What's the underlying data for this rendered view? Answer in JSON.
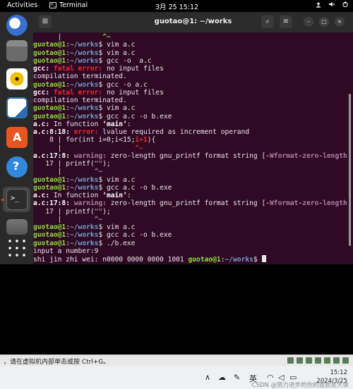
{
  "topbar": {
    "activities": "Activities",
    "app_name": "Terminal",
    "clock": "3月 25  15:12"
  },
  "dock": {
    "items": [
      {
        "icon": "thunderbird-icon"
      },
      {
        "icon": "files-icon"
      },
      {
        "icon": "rhythmbox-icon"
      },
      {
        "icon": "writer-icon"
      },
      {
        "icon": "app-center-icon"
      },
      {
        "icon": "help-icon"
      },
      {
        "icon": "terminal-icon"
      },
      {
        "icon": "drive-icon"
      },
      {
        "icon": "app-grid-icon"
      }
    ]
  },
  "terminal": {
    "title": "guotao@1: ~/works",
    "new_tab_icon": "new-tab-icon",
    "lines": [
      [
        {
          "t": "      |          ^~",
          "c": "g"
        }
      ],
      [
        {
          "t": "guotao@1",
          "c": "g"
        },
        {
          "t": ":",
          "c": ""
        },
        {
          "t": "~/works",
          "c": "b"
        },
        {
          "t": "$ vim a.c",
          "c": ""
        }
      ],
      [
        {
          "t": "guotao@1",
          "c": "g"
        },
        {
          "t": ":",
          "c": ""
        },
        {
          "t": "~/works",
          "c": "b"
        },
        {
          "t": "$ vim a.c",
          "c": ""
        }
      ],
      [
        {
          "t": "guotao@1",
          "c": "g"
        },
        {
          "t": ":",
          "c": ""
        },
        {
          "t": "~/works",
          "c": "b"
        },
        {
          "t": "$ gcc -o  a.c",
          "c": ""
        }
      ],
      [
        {
          "t": "gcc: ",
          "c": "w"
        },
        {
          "t": "fatal error: ",
          "c": "r"
        },
        {
          "t": "no input files",
          "c": ""
        }
      ],
      [
        {
          "t": "compilation terminated.",
          "c": ""
        }
      ],
      [
        {
          "t": "guotao@1",
          "c": "g"
        },
        {
          "t": ":",
          "c": ""
        },
        {
          "t": "~/works",
          "c": "b"
        },
        {
          "t": "$ gcc -o a.c",
          "c": ""
        }
      ],
      [
        {
          "t": "gcc: ",
          "c": "w"
        },
        {
          "t": "fatal error: ",
          "c": "r"
        },
        {
          "t": "no input files",
          "c": ""
        }
      ],
      [
        {
          "t": "compilation terminated.",
          "c": ""
        }
      ],
      [
        {
          "t": "guotao@1",
          "c": "g"
        },
        {
          "t": ":",
          "c": ""
        },
        {
          "t": "~/works",
          "c": "b"
        },
        {
          "t": "$ vim a.c",
          "c": ""
        }
      ],
      [
        {
          "t": "guotao@1",
          "c": "g"
        },
        {
          "t": ":",
          "c": ""
        },
        {
          "t": "~/works",
          "c": "b"
        },
        {
          "t": "$ gcc a.c -o b.exe",
          "c": ""
        }
      ],
      [
        {
          "t": "a.c:",
          "c": "w"
        },
        {
          "t": " In function ",
          "c": ""
        },
        {
          "t": "‘main’",
          "c": "w"
        },
        {
          "t": ":",
          "c": ""
        }
      ],
      [
        {
          "t": "a.c:8:18: ",
          "c": "w"
        },
        {
          "t": "error: ",
          "c": "r"
        },
        {
          "t": "lvalue required as increment operand",
          "c": ""
        }
      ],
      [
        {
          "t": "    8 | for(int i=0;i<15;",
          "c": ""
        },
        {
          "t": "i+1",
          "c": "r"
        },
        {
          "t": "){",
          "c": ""
        }
      ],
      [
        {
          "t": "      |                  ",
          "c": ""
        },
        {
          "t": "^~",
          "c": "r"
        }
      ],
      [
        {
          "t": "a.c:17:8: ",
          "c": "w"
        },
        {
          "t": "warning: ",
          "c": "m"
        },
        {
          "t": "zero-length gnu_printf format string [",
          "c": ""
        },
        {
          "t": "-Wformat-zero-length",
          "c": "m"
        },
        {
          "t": "]",
          "c": ""
        }
      ],
      [
        {
          "t": "   17 | printf(",
          "c": ""
        },
        {
          "t": "\"\"",
          "c": "m"
        },
        {
          "t": ");",
          "c": ""
        }
      ],
      [
        {
          "t": "      |        ",
          "c": ""
        },
        {
          "t": "^~",
          "c": "m"
        }
      ],
      [
        {
          "t": "guotao@1",
          "c": "g"
        },
        {
          "t": ":",
          "c": ""
        },
        {
          "t": "~/works",
          "c": "b"
        },
        {
          "t": "$ vim a.c",
          "c": ""
        }
      ],
      [
        {
          "t": "guotao@1",
          "c": "g"
        },
        {
          "t": ":",
          "c": ""
        },
        {
          "t": "~/works",
          "c": "b"
        },
        {
          "t": "$ gcc a.c -o b.exe",
          "c": ""
        }
      ],
      [
        {
          "t": "a.c:",
          "c": "w"
        },
        {
          "t": " In function ",
          "c": ""
        },
        {
          "t": "‘main’",
          "c": "w"
        },
        {
          "t": ":",
          "c": ""
        }
      ],
      [
        {
          "t": "a.c:17:8: ",
          "c": "w"
        },
        {
          "t": "warning: ",
          "c": "m"
        },
        {
          "t": "zero-length gnu_printf format string [",
          "c": ""
        },
        {
          "t": "-Wformat-zero-length",
          "c": "m"
        },
        {
          "t": "]",
          "c": ""
        }
      ],
      [
        {
          "t": "   17 | printf(",
          "c": ""
        },
        {
          "t": "\"\"",
          "c": "m"
        },
        {
          "t": ");",
          "c": ""
        }
      ],
      [
        {
          "t": "      |        ",
          "c": ""
        },
        {
          "t": "^~",
          "c": "m"
        }
      ],
      [
        {
          "t": "guotao@1",
          "c": "g"
        },
        {
          "t": ":",
          "c": ""
        },
        {
          "t": "~/works",
          "c": "b"
        },
        {
          "t": "$ vim a.c",
          "c": ""
        }
      ],
      [
        {
          "t": "guotao@1",
          "c": "g"
        },
        {
          "t": ":",
          "c": ""
        },
        {
          "t": "~/works",
          "c": "b"
        },
        {
          "t": "$ gcc a.c -o b.exe",
          "c": ""
        }
      ],
      [
        {
          "t": "guotao@1",
          "c": "g"
        },
        {
          "t": ":",
          "c": ""
        },
        {
          "t": "~/works",
          "c": "b"
        },
        {
          "t": "$ ./b.exe",
          "c": ""
        }
      ],
      [
        {
          "t": "input a number:9",
          "c": ""
        }
      ],
      [
        {
          "t": "shi jin zhi wei: n0000 0000 0000 1001 ",
          "c": ""
        },
        {
          "t": "guotao@1",
          "c": "g"
        },
        {
          "t": ":",
          "c": ""
        },
        {
          "t": "~/works",
          "c": "b"
        },
        {
          "t": "$ ",
          "c": ""
        },
        {
          "t": "",
          "c": "cursor"
        }
      ]
    ]
  },
  "vmbar": {
    "hint": "，请在虚拟机内部单击或按 Ctrl+G。"
  },
  "taskbar": {
    "ime": "英",
    "time": "15:12",
    "date": "2024/3/25",
    "watermark": "CSDN @努力进步的你",
    "watermark_overlap": "的我就是大侠"
  }
}
